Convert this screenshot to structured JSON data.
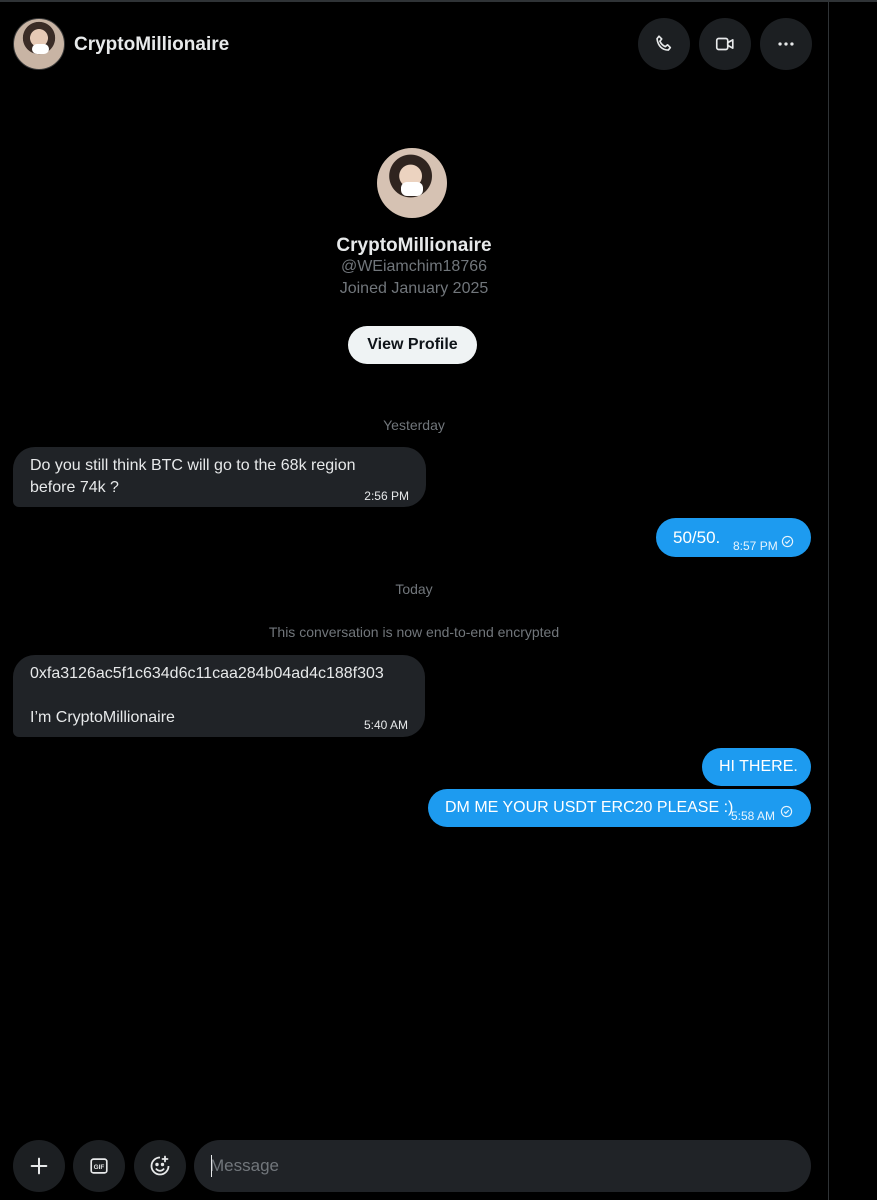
{
  "header": {
    "name": "CryptoMillionaire",
    "icons": [
      "phone-icon",
      "video-icon",
      "more-icon"
    ]
  },
  "profile": {
    "name": "CryptoMillionaire",
    "handle": "@WEiamchim18766",
    "joined": "Joined January 2025",
    "view_profile_label": "View Profile"
  },
  "conversation": {
    "day_labels": [
      "Yesterday",
      "Today"
    ],
    "encryption_note": "This conversation is now end-to-end encrypted",
    "messages": [
      {
        "direction": "incoming",
        "text": "Do you still think BTC will go to the 68k region\nbefore 74k ?",
        "time": "2:56 PM"
      },
      {
        "direction": "outgoing",
        "text": "50/50.",
        "time": "8:57 PM",
        "status": "sent"
      },
      {
        "direction": "incoming",
        "text": "0xfa3126ac5f1c634d6c11caa284b04ad4c188f303\n\nI’m CryptoMillionaire",
        "time": "5:40 AM"
      },
      {
        "direction": "outgoing",
        "text": "HI THERE.",
        "time": ""
      },
      {
        "direction": "outgoing",
        "text": "DM ME YOUR USDT ERC20 PLEASE :)",
        "time": "5:58 AM",
        "status": "sent"
      }
    ]
  },
  "composer": {
    "placeholder": "Message",
    "buttons": [
      "plus-icon",
      "gif-icon",
      "emoji-icon"
    ]
  },
  "colors": {
    "background": "#000000",
    "incoming_bubble": "#202327",
    "outgoing_bubble": "#1d9bf0",
    "muted_text": "#71767b"
  }
}
